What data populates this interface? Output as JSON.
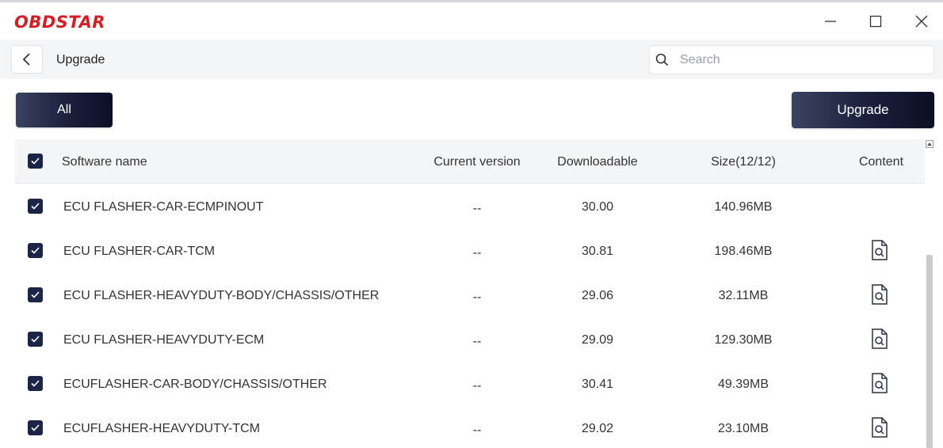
{
  "app": {
    "logo_text": "OBDSTAR",
    "brand_color": "#d11f26"
  },
  "window_controls": [
    "minimize-icon",
    "maximize-icon",
    "close-icon"
  ],
  "nav": {
    "title": "Upgrade",
    "search_placeholder": "Search"
  },
  "toolbar": {
    "filter_label": "All",
    "upgrade_label": "Upgrade"
  },
  "table": {
    "headers": {
      "name": "Software name",
      "current": "Current version",
      "downloadable": "Downloadable",
      "size": "Size(12/12)",
      "content": "Content"
    },
    "rows": [
      {
        "name": "ECU FLASHER-CAR-ECMPINOUT",
        "current": "--",
        "downloadable": "30.00",
        "size": "140.96MB",
        "checked": true,
        "has_content": false
      },
      {
        "name": "ECU FLASHER-CAR-TCM",
        "current": "--",
        "downloadable": "30.81",
        "size": "198.46MB",
        "checked": true,
        "has_content": true
      },
      {
        "name": "ECU FLASHER-HEAVYDUTY-BODY/CHASSIS/OTHER",
        "current": "--",
        "downloadable": "29.06",
        "size": "32.11MB",
        "checked": true,
        "has_content": true
      },
      {
        "name": "ECU FLASHER-HEAVYDUTY-ECM",
        "current": "--",
        "downloadable": "29.09",
        "size": "129.30MB",
        "checked": true,
        "has_content": true
      },
      {
        "name": "ECUFLASHER-CAR-BODY/CHASSIS/OTHER",
        "current": "--",
        "downloadable": "30.41",
        "size": "49.39MB",
        "checked": true,
        "has_content": true
      },
      {
        "name": "ECUFLASHER-HEAVYDUTY-TCM",
        "current": "--",
        "downloadable": "29.02",
        "size": "23.10MB",
        "checked": true,
        "has_content": true
      }
    ]
  }
}
